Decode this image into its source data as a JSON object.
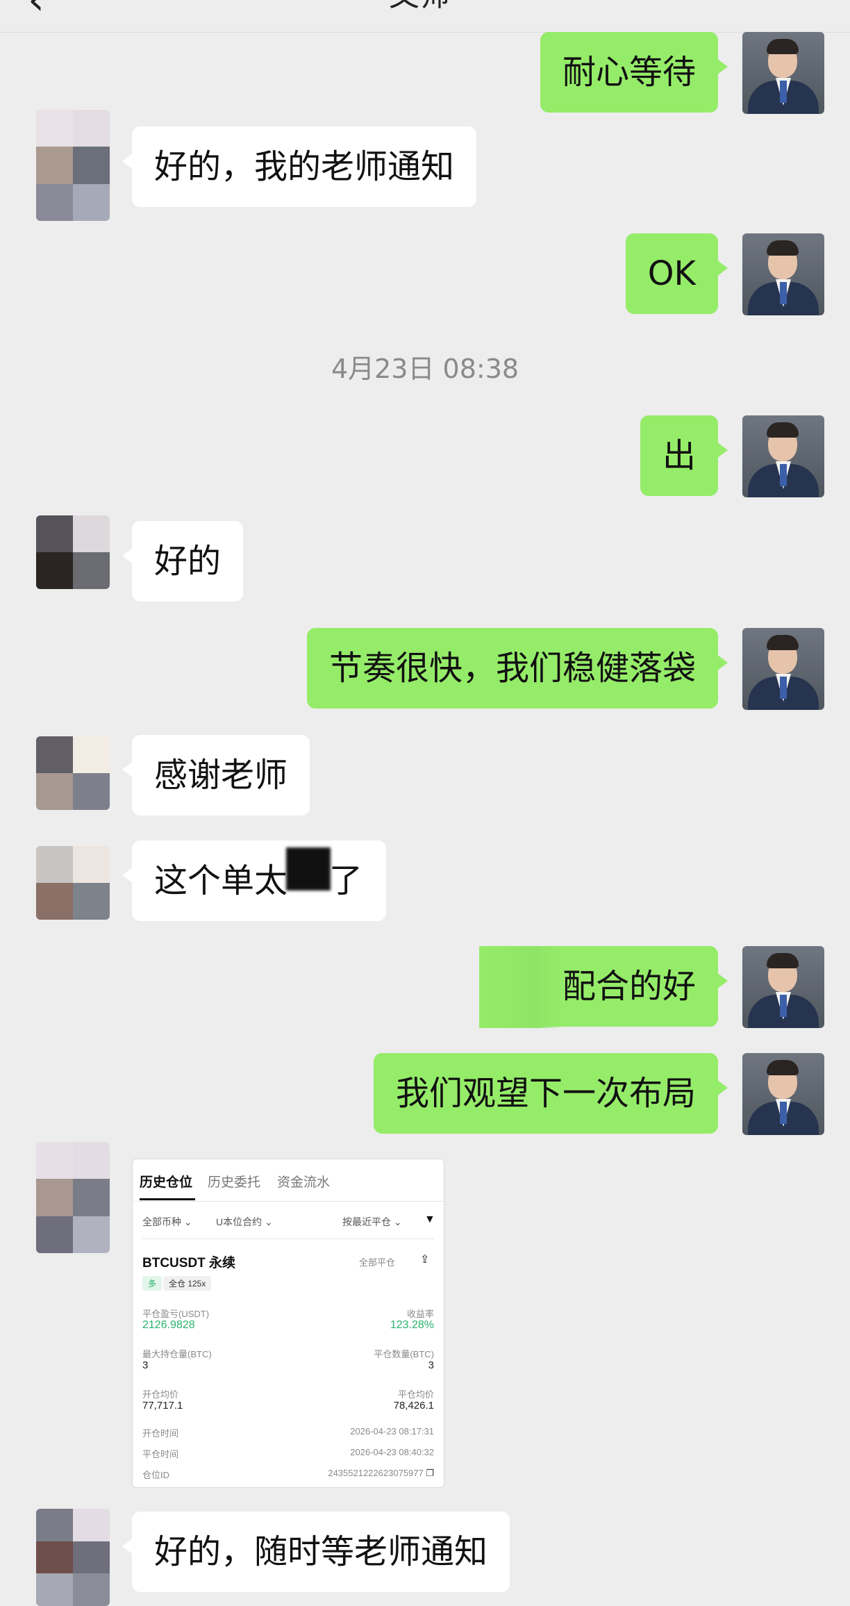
{
  "header": {
    "back_icon": "chevron-left-icon",
    "title": "文师"
  },
  "messages": [
    {
      "side": "right",
      "text": "耐心等待"
    },
    {
      "side": "left",
      "text": "好的，我的老师通知"
    },
    {
      "side": "right",
      "text": "OK"
    },
    {
      "side": "time",
      "text": "4月23日 08:38"
    },
    {
      "side": "right",
      "text": "出"
    },
    {
      "side": "left",
      "text": "好的"
    },
    {
      "side": "right",
      "text": "节奏很快，我们稳健落袋"
    },
    {
      "side": "left",
      "text": "感谢老师"
    },
    {
      "side": "left",
      "text": "这个单太",
      "tail": "了"
    },
    {
      "side": "right",
      "text": "配合的好"
    },
    {
      "side": "right",
      "text": "我们观望下一次布局"
    },
    {
      "side": "left",
      "text": "好的，随时等老师通知"
    }
  ],
  "trade_card": {
    "tabs": [
      "历史仓位",
      "历史委托",
      "资金流水"
    ],
    "filters": {
      "coin": "全部币种",
      "contract": "U本位合约",
      "sort": "按最近平仓"
    },
    "symbol": "BTCUSDT 永续",
    "close_type": "全部平仓",
    "side_badge": "多",
    "margin_badge": "全仓 125x",
    "pnl_label": "平仓盈亏(USDT)",
    "pnl_value": "2126.9828",
    "roi_label": "收益率",
    "roi_value": "123.28%",
    "max_pos_label": "最大持仓量(BTC)",
    "max_pos_value": "3",
    "close_qty_label": "平仓数量(BTC)",
    "close_qty_value": "3",
    "open_avg_label": "开仓均价",
    "open_avg_value": "77,717.1",
    "close_avg_label": "平仓均价",
    "close_avg_value": "78,426.1",
    "open_time_label": "开仓时间",
    "open_time_value": "2026-04-23 08:17:31",
    "close_time_label": "平仓时间",
    "close_time_value": "2026-04-23 08:40:32",
    "position_id_label": "仓位ID",
    "position_id_value": "2435521222623075977"
  },
  "colors": {
    "my_bubble": "#95ec69",
    "their_bubble": "#ffffff",
    "background": "#ededed",
    "profit_green": "#27b26b"
  }
}
